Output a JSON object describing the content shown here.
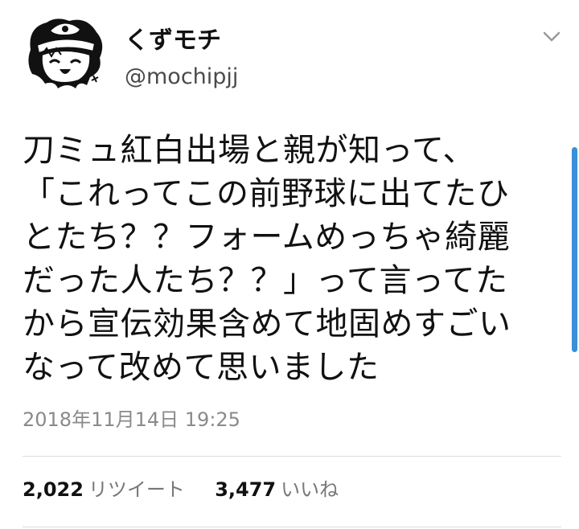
{
  "user": {
    "display_name": "くずモチ",
    "username": "@mochipjj"
  },
  "tweet": {
    "lines": [
      "刀ミュ紅白出場と親が知って、",
      "「これってこの前野球に出てたひ",
      "とたち？？フォームめっちゃ綺麗",
      "だった人たち？？」って言ってた",
      "から宣伝効果含めて地固めすごい",
      "なって改めて思いました"
    ],
    "timestamp": "2018年11月14日 19:25"
  },
  "stats": {
    "retweets_count": "2,022",
    "retweets_label": "リツイート",
    "likes_count": "3,477",
    "likes_label": "いいね"
  },
  "icons": {
    "avatar": "cartoon-avatar",
    "menu": "chevron-down-icon"
  },
  "colors": {
    "text": "#111111",
    "secondary_text": "#8a8a8a",
    "divider": "#dddddd",
    "scrollbar": "#3a8fd9"
  }
}
